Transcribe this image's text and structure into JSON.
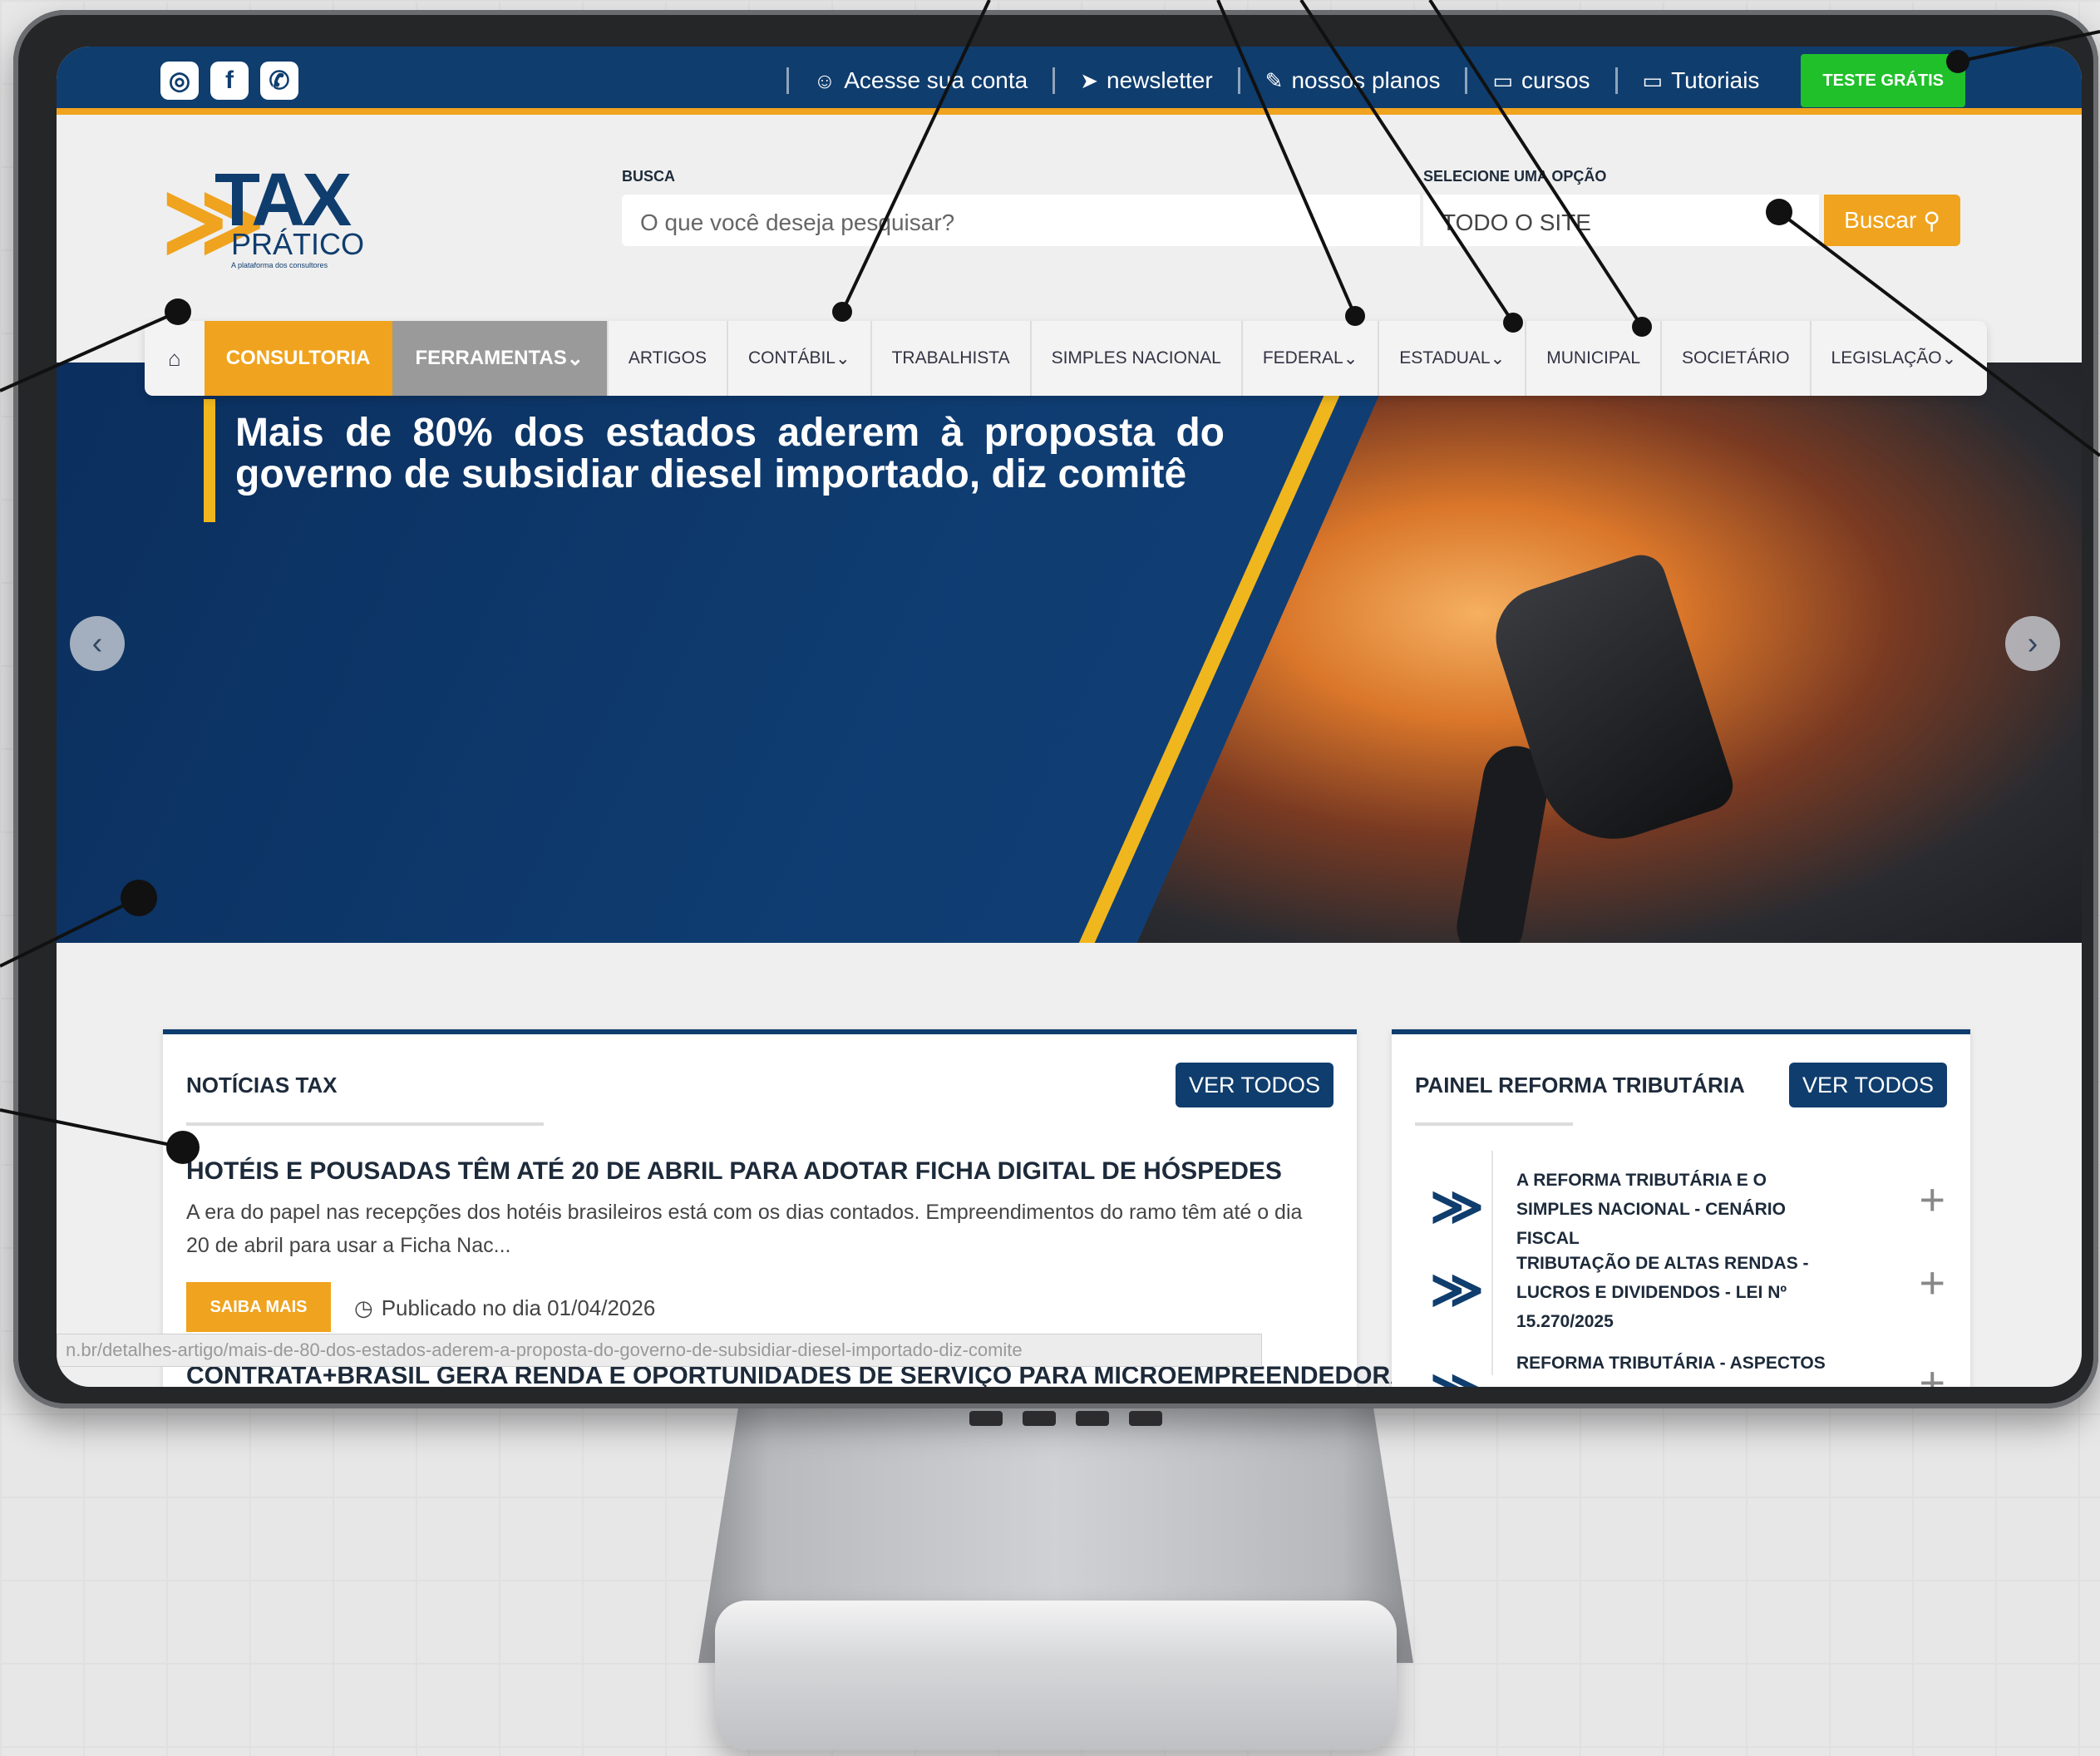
{
  "topbar": {
    "social": [
      "instagram-icon",
      "facebook-icon",
      "whatsapp-icon"
    ],
    "links": [
      {
        "label": "Acesse sua conta",
        "icon": "user-icon"
      },
      {
        "label": "newsletter",
        "icon": "send-icon"
      },
      {
        "label": "nossos planos",
        "icon": "edit-icon"
      },
      {
        "label": "cursos",
        "icon": "book-icon"
      },
      {
        "label": "Tutoriais",
        "icon": "book-icon"
      }
    ],
    "cta": "TESTE GRÁTIS"
  },
  "logo": {
    "tax": "TAX",
    "pratico": "PRÁTICO",
    "tagline": "A plataforma dos consultores"
  },
  "search": {
    "label": "BUSCA",
    "placeholder": "O que você deseja pesquisar?",
    "select_label": "SELECIONE UMA OPÇÃO",
    "select_value": "TODO O SITE",
    "button": "Buscar"
  },
  "nav": {
    "items": [
      "CONSULTORIA",
      "FERRAMENTAS",
      "ARTIGOS",
      "CONTÁBIL",
      "TRABALHISTA",
      "SIMPLES NACIONAL",
      "FEDERAL",
      "ESTADUAL",
      "MUNICIPAL",
      "SOCIETÁRIO",
      "LEGISLAÇÃO"
    ]
  },
  "hero": {
    "headline": "Mais de 80% dos estados aderem à proposta do governo de subsidiar diesel importado, diz comitê"
  },
  "news": {
    "title": "NOTÍCIAS TAX",
    "view_all": "VER TODOS",
    "item_title": "HOTÉIS E POUSADAS TÊM ATÉ 20 DE ABRIL PARA ADOTAR FICHA DIGITAL DE HÓSPEDES",
    "item_excerpt": "A era do papel nas recepções dos hotéis brasileiros está com os dias contados. Empreendimentos do ramo têm até o dia 20 de abril para usar a Ficha Nac...",
    "more": "SAIBA MAIS",
    "published": "Publicado no dia 01/04/2026",
    "item2_title": "CONTRATA+BRASIL GERA RENDA E OPORTUNIDADES DE SERVIÇO PARA MICROEMPREENDEDORA"
  },
  "status_url": "n.br/detalhes-artigo/mais-de-80-dos-estados-aderem-a-proposta-do-governo-de-subsidiar-diesel-importado-diz-comite",
  "reforma": {
    "title": "PAINEL REFORMA TRIBUTÁRIA",
    "view_all": "VER TODOS",
    "items": [
      "A REFORMA TRIBUTÁRIA E O SIMPLES NACIONAL - CENÁRIO FISCAL",
      "TRIBUTAÇÃO DE ALTAS RENDAS - LUCROS E DIVIDENDOS - LEI Nº 15.270/2025",
      "REFORMA TRIBUTÁRIA - ASPECTOS"
    ]
  },
  "colors": {
    "brand_blue": "#0f3d6e",
    "accent_orange": "#f0a31e",
    "cta_green": "#20c02a",
    "hero_yellow": "#f0b61e"
  }
}
